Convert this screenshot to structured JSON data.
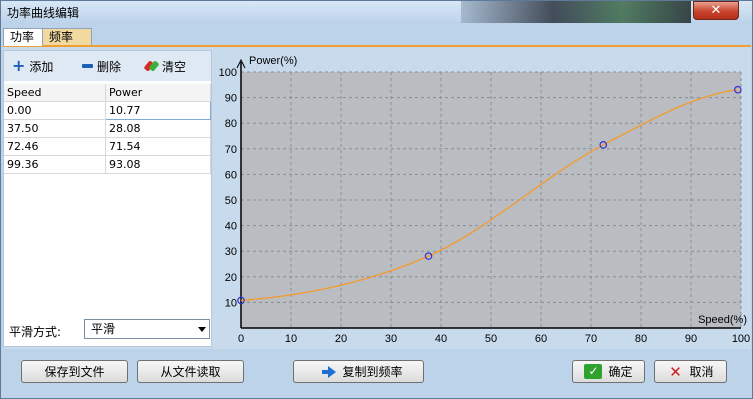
{
  "window": {
    "title": "功率曲线编辑",
    "close_label": "✕"
  },
  "tabs": [
    {
      "label": "功率"
    },
    {
      "label": "频率"
    }
  ],
  "toolbar": {
    "add_label": "添加",
    "delete_label": "删除",
    "clear_label": "清空"
  },
  "table": {
    "headers": [
      "Speed",
      "Power"
    ],
    "rows": [
      [
        "0.00",
        "10.77"
      ],
      [
        "37.50",
        "28.08"
      ],
      [
        "72.46",
        "71.54"
      ],
      [
        "99.36",
        "93.08"
      ]
    ]
  },
  "smooth": {
    "label": "平滑方式:",
    "value": "平滑"
  },
  "buttons": {
    "save": "保存到文件",
    "load": "从文件读取",
    "copy": "复制到频率",
    "ok": "确定",
    "cancel": "取消"
  },
  "chart_data": {
    "type": "line",
    "ylabel": "Power(%)",
    "xlabel": "Speed(%)",
    "xlim": [
      0,
      100
    ],
    "ylim": [
      0,
      100
    ],
    "xticks": [
      0,
      10,
      20,
      30,
      40,
      50,
      60,
      70,
      80,
      90,
      100
    ],
    "yticks": [
      10,
      20,
      30,
      40,
      50,
      60,
      70,
      80,
      90,
      100
    ],
    "grid": true,
    "points": [
      {
        "x": 0.0,
        "y": 10.77
      },
      {
        "x": 37.5,
        "y": 28.08
      },
      {
        "x": 72.46,
        "y": 71.54
      },
      {
        "x": 99.36,
        "y": 93.08
      }
    ],
    "curve_color": "#f59a2a",
    "point_color": "#3030d0"
  }
}
